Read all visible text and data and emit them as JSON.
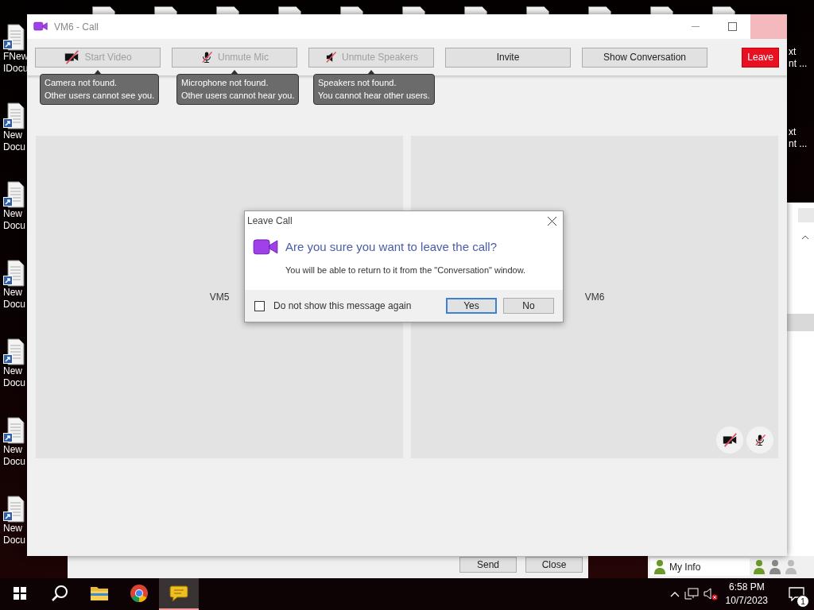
{
  "desktop": {
    "icons": [
      {
        "lines": [
          "FNew",
          "IDocu"
        ]
      },
      {
        "lines": [
          "New",
          "Docu"
        ]
      },
      {
        "lines": [
          "New",
          "Docu"
        ]
      },
      {
        "lines": [
          "New",
          "Docu"
        ]
      },
      {
        "lines": [
          "New",
          "Docu"
        ]
      },
      {
        "lines": [
          "New",
          "Docu"
        ]
      },
      {
        "lines": [
          "New",
          "Docu"
        ]
      }
    ],
    "right_labels": [
      {
        "lines": [
          "xt",
          "nt ..."
        ]
      },
      {
        "lines": [
          "xt",
          "nt ..."
        ]
      }
    ]
  },
  "call_window": {
    "title": "VM6 - Call",
    "toolbar": [
      {
        "kind": "video",
        "label": "Start Video",
        "disabled": true,
        "tooltip": "Camera not found.\nOther users cannot see you."
      },
      {
        "kind": "mic",
        "label": "Unmute Mic",
        "disabled": true,
        "tooltip": "Microphone not found.\nOther users cannot hear you."
      },
      {
        "kind": "speaker",
        "label": "Unmute Speakers",
        "disabled": true,
        "tooltip": "Speakers not found.\nYou cannot hear other users."
      },
      {
        "kind": "plain",
        "label": "Invite",
        "disabled": false
      },
      {
        "kind": "plain",
        "label": "Show Conversation",
        "disabled": false
      }
    ],
    "leave_button": "Leave",
    "tiles": [
      {
        "name": "VM5",
        "camera_off": false,
        "mic_off": false
      },
      {
        "name": "VM6",
        "camera_off": true,
        "mic_off": true
      }
    ]
  },
  "dialog": {
    "title": "Leave Call",
    "heading": "Are you sure you want to leave the call?",
    "message": "You will be able to return to it from the \"Conversation\" window.",
    "checkbox": {
      "label": "Do not show this message again",
      "checked": false
    },
    "buttons": [
      {
        "label": "Yes",
        "selected": true
      },
      {
        "label": "No",
        "selected": false
      }
    ]
  },
  "chat_window": {
    "buttons": [
      "Send",
      "Close"
    ]
  },
  "contacts_window": {
    "my_info": "My Info"
  },
  "taskbar": {
    "apps": [
      {
        "kind": "search",
        "active": false
      },
      {
        "kind": "folder",
        "active": false
      },
      {
        "kind": "browser",
        "active": false
      },
      {
        "kind": "chat",
        "active": true
      }
    ],
    "time": "6:58 PM",
    "date": "10/7/2023",
    "notifications": "1"
  }
}
